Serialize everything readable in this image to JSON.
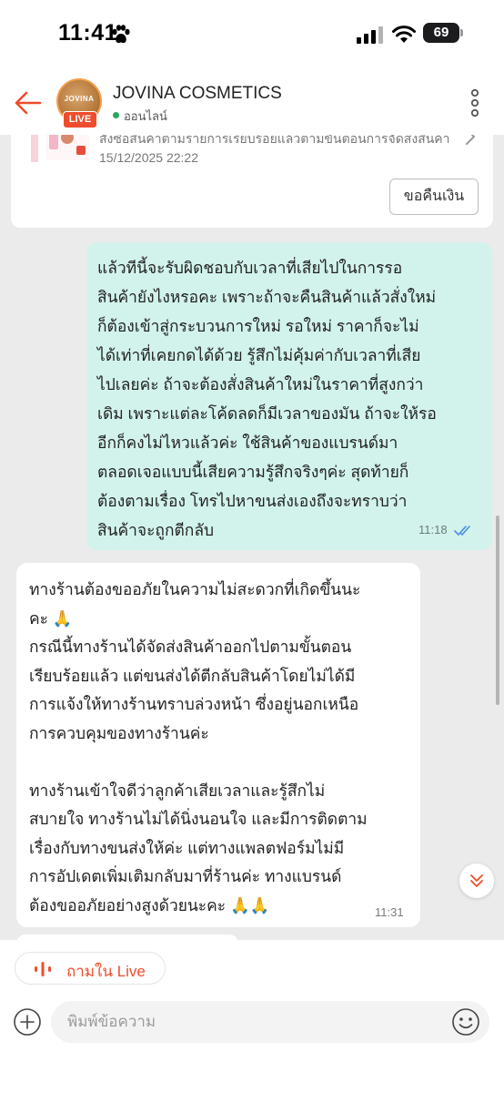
{
  "status_bar": {
    "time": "11:41",
    "battery": "69"
  },
  "header": {
    "shop_name": "JOVINA COSMETICS",
    "status": "ออนไลน์",
    "avatar_text": "JOVINA",
    "live_badge": "LIVE"
  },
  "order_card": {
    "title": "สั่งซื้อสินค้าตามรายการเรียบร้อยแล้วตามขั้นตอนการจัดส่งสินค้าได้ทันที",
    "date": "15/12/2025 22:22",
    "refund_button": "ขอคืนเงิน"
  },
  "messages": [
    {
      "direction": "outgoing",
      "text": "แล้วทีนี้จะรับผิดชอบกับเวลาที่เสียไปในการรอ\nสินค้ายังไงหรอคะ เพราะถ้าจะคืนสินค้าแล้วสั่งใหม่\nก็ต้องเข้าสู่กระบวนการใหม่ รอใหม่ ราคาก็จะไม่\nได้เท่าที่เคยกดได้ด้วย รู้สึกไม่คุ้มค่ากับเวลาที่เสีย\nไปเลยค่ะ ถ้าจะต้องสั่งสินค้าใหม่ในราคาที่สูงกว่า\nเดิม เพราะแต่ละโค้ดลดก็มีเวลาของมัน ถ้าจะให้รอ\nอีกก็คงไม่ไหวแล้วค่ะ ใช้สินค้าของแบรนด์มา\nตลอดเจอแบบนี้เสียความรู้สึกจริงๆค่ะ สุดท้ายก็\nต้องตามเรื่อง โทรไปหาขนส่งเองถึงจะทราบว่า\nสินค้าจะถูกตีกลับ",
      "time": "11:18"
    },
    {
      "direction": "incoming",
      "text": "ทางร้านต้องขออภัยในความไม่สะดวกที่เกิดขึ้นนะ\nคะ 🙏\nกรณีนี้ทางร้านได้จัดส่งสินค้าออกไปตามขั้นตอน\nเรียบร้อยแล้ว แต่ขนส่งได้ตีกลับสินค้าโดยไม่ได้มี\nการแจ้งให้ทางร้านทราบล่วงหน้า ซึ่งอยู่นอกเหนือ\nการควบคุมของทางร้านค่ะ\n\nทางร้านเข้าใจดีว่าลูกค้าเสียเวลาและรู้สึกไม่\nสบายใจ ทางร้านไม่ได้นิ่งนอนใจ และมีการติดตาม\nเรื่องกับทางขนส่งให้ค่ะ แต่ทางแพลตฟอร์มไม่มี\nการอัปเดตเพิ่มเติมกลับมาที่ร้านค่ะ ทางแบรนด์\nต้องขออภัยอย่างสูงด้วยนะคะ 🙏🙏",
      "time": "11:31"
    }
  ],
  "bottom_bar": {
    "ask_live_label": "ถามใน Live",
    "input_placeholder": "พิมพ์ข้อความ"
  },
  "colors": {
    "accent": "#ee4d2d",
    "outgoing_bubble": "#d2f3ec",
    "online": "#26aa5d",
    "read_tick": "#4a90e2"
  },
  "icons": [
    "paw-icon",
    "signal-icon",
    "wifi-icon",
    "back-arrow-icon",
    "more-vertical-icon",
    "chevron-right-icon",
    "double-check-icon",
    "chevrons-down-icon",
    "live-audio-icon",
    "plus-circle-icon",
    "emoji-icon"
  ]
}
